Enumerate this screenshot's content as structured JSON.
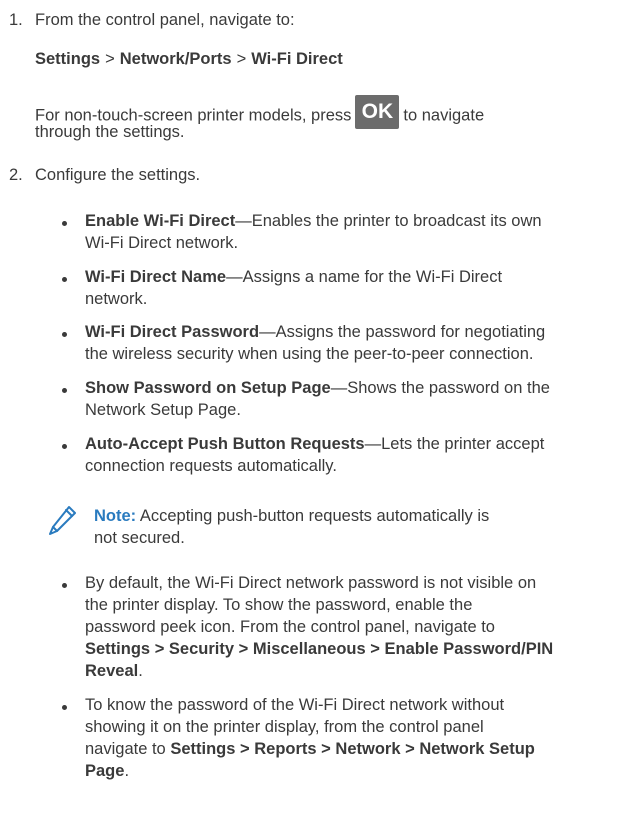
{
  "steps": [
    {
      "number": "1.",
      "text": "From the control panel, navigate to:"
    },
    {
      "number": "2.",
      "text": "Configure the settings."
    }
  ],
  "nav_path": [
    "Settings",
    "Network/Ports",
    "Wi-Fi Direct"
  ],
  "path_separator": ">",
  "non_touch": {
    "before": "For non-touch-screen printer models, press",
    "button": "OK",
    "after": "to navigate",
    "line2": "through the settings."
  },
  "settings": [
    {
      "term": "Enable Wi-Fi Direct",
      "line1": "—Enables the printer to broadcast its own",
      "line2": "Wi-Fi Direct network."
    },
    {
      "term": "Wi-Fi Direct Name",
      "line1": "—Assigns a name for the Wi-Fi Direct",
      "line2": "network."
    },
    {
      "term": "Wi-Fi Direct Password",
      "line1": "—Assigns the password for negotiating",
      "line2": "the wireless security when using the peer-to-peer connection."
    },
    {
      "term": "Show Password on Setup Page",
      "line1": "—Shows the password on the",
      "line2": "Network Setup Page."
    },
    {
      "term": "Auto-Accept Push Button Requests",
      "line1": "—Lets the printer accept",
      "line2": "connection requests automatically."
    }
  ],
  "note": {
    "label": "Note:",
    "line1": "Accepting push-button requests automatically is",
    "line2": "not secured.",
    "icon": "pencil-icon",
    "color": "#2a7bbf"
  },
  "tips": {
    "tip1": {
      "l1": "By default, the Wi-Fi Direct network password is not visible on",
      "l2": "the printer display. To show the password, enable the",
      "l3": "password peek icon. From the control panel, navigate to",
      "path1": [
        "Settings",
        "Security",
        "Miscellaneous",
        "Enable Password/PIN"
      ],
      "path2": "Reveal",
      "end": "."
    },
    "tip2": {
      "l1": "To know the password of the Wi-Fi Direct network without",
      "l2": "showing it on the printer display, from the control panel",
      "l3_text": "navigate to ",
      "path1": [
        "Settings",
        "Reports",
        "Network",
        "Network Setup"
      ],
      "path2": "Page",
      "end": "."
    }
  }
}
